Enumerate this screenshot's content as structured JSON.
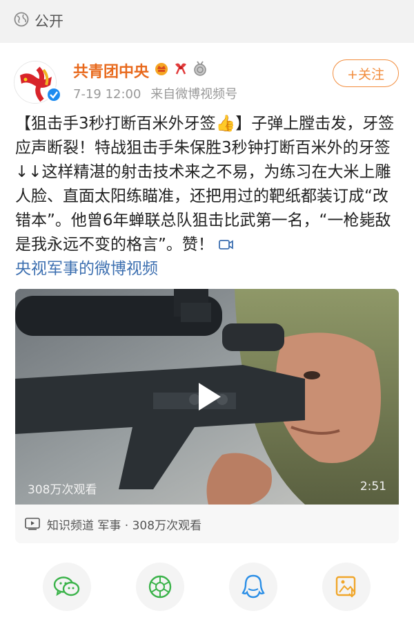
{
  "header": {
    "globe_icon": "globe-icon",
    "visibility": "公开"
  },
  "post": {
    "author": "共青团中央",
    "badges": [
      "crown-badge-icon",
      "ribbon-badge-icon",
      "medal-badge-icon"
    ],
    "time": "7-19 12:00",
    "source": "来自微博视频号",
    "follow_label": "+关注",
    "text_before_emoji": "【狙击手3秒打断百米外牙签",
    "emoji": "👍",
    "text_main": "】子弹上膛击发，牙签应声断裂！特战狙击手朱保胜3秒钟打断百米外的牙签↓↓这样精湛的射击技术来之不易，为练习在大米上雕人脸、直面太阳练瞄准，还把用过的靶纸都装订成“改错本”。他曾6年蝉联总队狙击比武第一名，“一枪毙敌是我永远不变的格言”。赞！",
    "link_text": "央视军事的微博视频"
  },
  "video": {
    "views_overlay": "308万次观看",
    "duration": "2:51",
    "info_text": "知识频道 军事 · 308万次观看"
  },
  "share": {
    "items": [
      "wechat-icon",
      "moments-icon",
      "qq-icon",
      "save-image-icon"
    ]
  },
  "colors": {
    "author": "#e8691c",
    "follow": "#f28c3c",
    "link": "#3c6fb0",
    "verified": "#1e8cf0"
  }
}
